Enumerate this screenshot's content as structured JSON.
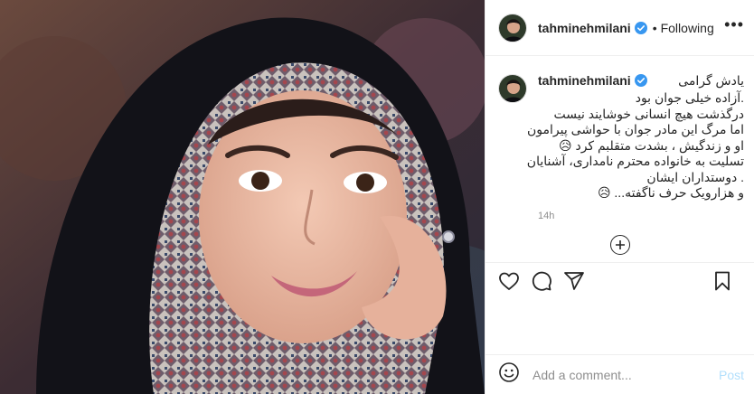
{
  "post": {
    "image_alt": "Portrait photo of a woman wearing a patterned headscarf"
  },
  "header": {
    "username": "tahminehmilani",
    "separator": "•",
    "follow_status": "Following",
    "more_icon": "more-horizontal-icon",
    "verified_icon": "verified-badge-icon"
  },
  "caption": {
    "username": "tahminehmilani",
    "lines": [
      "یادش گرامی",
      ".آزاده خیلی جوان بود",
      "درگذشت هیچ انسانی خوشایند نیست",
      "اما مرگ این مادر جوان با حواشی پیرامون",
      "او و زندگیش ، بشدت متقلبم کرد 😥",
      "تسلیت به خانواده محترم نامداری، آشنایان",
      ". دوستداران ایشان",
      "و هزارویک حرف ناگفته... 😥"
    ],
    "timestamp": "14h"
  },
  "actions": {
    "like_icon": "heart-icon",
    "comment_icon": "comment-icon",
    "share_icon": "paper-plane-icon",
    "save_icon": "bookmark-icon",
    "load_more_icon": "plus-circle-icon"
  },
  "comment_box": {
    "emoji_icon": "emoji-icon",
    "placeholder": "Add a comment...",
    "post_label": "Post"
  },
  "colors": {
    "verified_blue": "#3897f0",
    "post_disabled": "#b2dffc",
    "muted_text": "#8e8e8e",
    "divider": "#efefef"
  }
}
